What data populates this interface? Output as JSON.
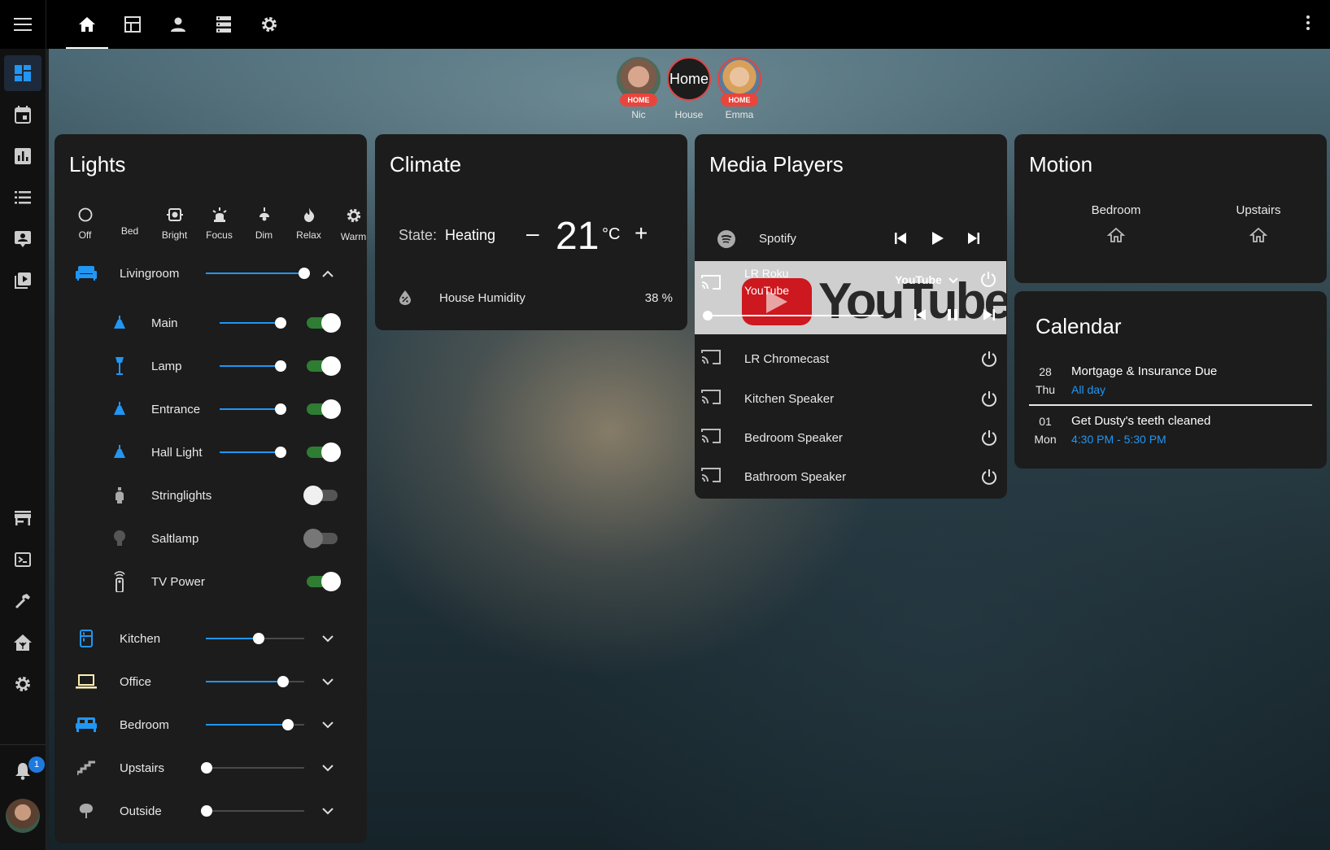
{
  "tabs": [
    "home-icon",
    "dashboard-icon",
    "person-icon",
    "server-icon",
    "gear-icon"
  ],
  "persons": [
    {
      "name": "Nic",
      "tag": "HOME"
    },
    {
      "name": "House",
      "avatar_text": "Home"
    },
    {
      "name": "Emma",
      "tag": "HOME"
    }
  ],
  "sidebar": {
    "notification_count": "1"
  },
  "lights": {
    "title": "Lights",
    "presets": [
      "Off",
      "Bed",
      "Bright",
      "Focus",
      "Dim",
      "Relax",
      "Warm"
    ],
    "groups": [
      {
        "name": "Livingroom",
        "brightness": 100
      },
      {
        "name": "Kitchen",
        "brightness": 54
      },
      {
        "name": "Office",
        "brightness": 79
      },
      {
        "name": "Bedroom",
        "brightness": 85
      },
      {
        "name": "Upstairs",
        "brightness": 0
      },
      {
        "name": "Outside",
        "brightness": 0
      }
    ],
    "items": [
      {
        "name": "Main",
        "brightness": 100,
        "on": true
      },
      {
        "name": "Lamp",
        "brightness": 100,
        "on": true
      },
      {
        "name": "Entrance",
        "brightness": 100,
        "on": true
      },
      {
        "name": "Hall Light",
        "brightness": 100,
        "on": true
      },
      {
        "name": "Stringlights",
        "on": false
      },
      {
        "name": "Saltlamp",
        "on": false
      },
      {
        "name": "TV Power",
        "on": true
      }
    ]
  },
  "climate": {
    "title": "Climate",
    "state_label": "State:",
    "state_value": "Heating",
    "temperature": "21",
    "unit": "°C",
    "minus": "–",
    "plus": "+",
    "humidity_label": "House Humidity",
    "humidity_value": "38 %"
  },
  "media": {
    "title": "Media Players",
    "spotify": "Spotify",
    "roku": {
      "name": "LR Roku",
      "app": "YouTube",
      "source": "YouTube",
      "logo_text": "YouTube"
    },
    "players": [
      "LR Chromecast",
      "Kitchen Speaker",
      "Bedroom Speaker",
      "Bathroom Speaker"
    ]
  },
  "motion": {
    "title": "Motion",
    "sensors": [
      "Bedroom",
      "Upstairs"
    ]
  },
  "calendar": {
    "title": "Calendar",
    "events": [
      {
        "day": "28",
        "weekday": "Thu",
        "title": "Mortgage & Insurance Due",
        "when": "All day"
      },
      {
        "day": "01",
        "weekday": "Mon",
        "title": "Get Dusty's teeth cleaned",
        "when": "4:30 PM - 5:30 PM"
      }
    ]
  },
  "colors": {
    "accent": "#2196f3",
    "toggle_on": "#2e7d32",
    "home_badge": "#e8453c"
  }
}
